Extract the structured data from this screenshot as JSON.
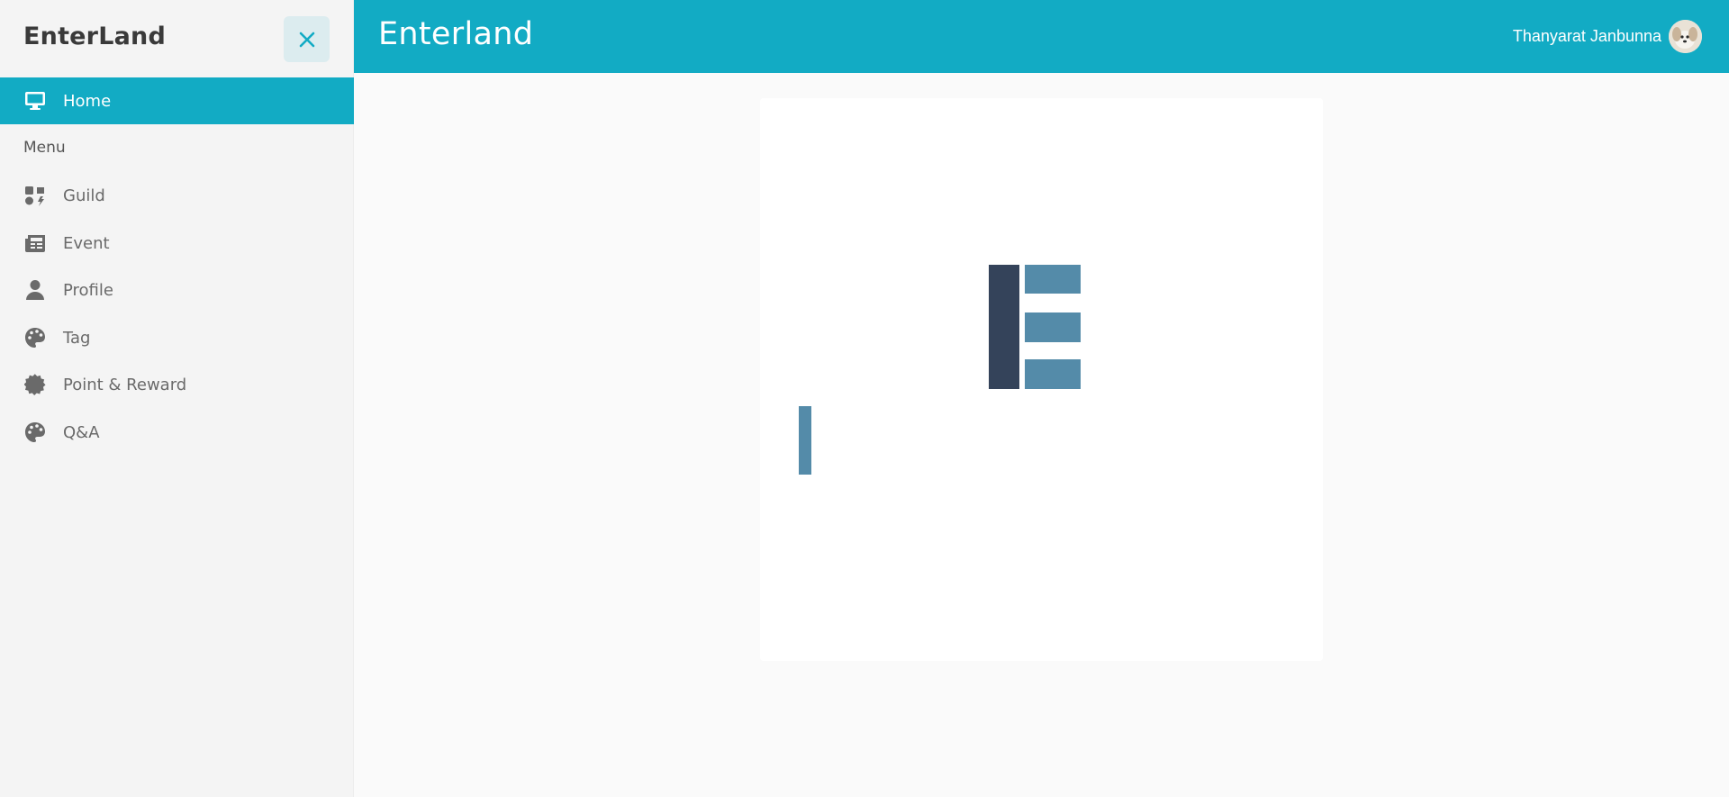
{
  "sidebar": {
    "brand": "EnterLand",
    "close_icon": "close-icon",
    "menu_heading": "Menu",
    "items": [
      {
        "label": "Home",
        "icon": "monitor-icon",
        "active": true
      },
      {
        "label": "Guild",
        "icon": "guild-icon",
        "active": false
      },
      {
        "label": "Event",
        "icon": "newspaper-icon",
        "active": false
      },
      {
        "label": "Profile",
        "icon": "user-icon",
        "active": false
      },
      {
        "label": "Tag",
        "icon": "palette-icon",
        "active": false
      },
      {
        "label": "Point & Reward",
        "icon": "badge-icon",
        "active": false
      },
      {
        "label": "Q&A",
        "icon": "palette-icon",
        "active": false
      }
    ]
  },
  "header": {
    "title": "Enterland",
    "user_name": "Thanyarat Janbunna",
    "avatar_icon": "avatar-photo"
  },
  "main": {
    "logo_icon": "enterland-logo-icon",
    "loading_icon": "loading-bar-icon"
  },
  "colors": {
    "accent": "#12abc4",
    "logo_dark": "#34435a",
    "logo_light": "#548ba9",
    "sidebar_bg": "#f4f4f4",
    "text_muted": "#6a6a6a"
  }
}
